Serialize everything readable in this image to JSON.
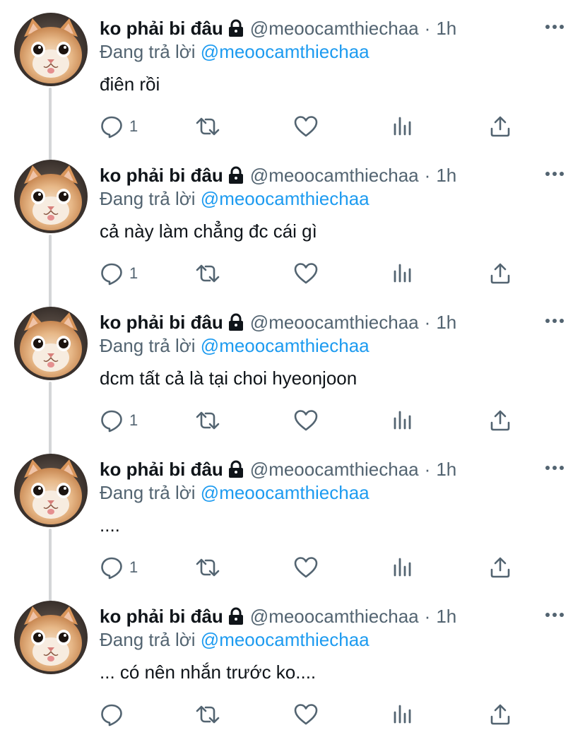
{
  "colors": {
    "text": "#0f1419",
    "secondary": "#536471",
    "link": "#1d9bf0",
    "thread": "#d4d6d8"
  },
  "tweets": [
    {
      "display_name": "ko phải bi đâu",
      "handle": "@meoocamthiechaa",
      "separator": "·",
      "time": "1h",
      "reply_prefix": "Đang trả lời",
      "reply_to": "@meoocamthiechaa",
      "text": "điên rồi",
      "reply_count": "1"
    },
    {
      "display_name": "ko phải bi đâu",
      "handle": "@meoocamthiechaa",
      "separator": "·",
      "time": "1h",
      "reply_prefix": "Đang trả lời",
      "reply_to": "@meoocamthiechaa",
      "text": "cả này làm chẳng đc cái gì",
      "reply_count": "1"
    },
    {
      "display_name": "ko phải bi đâu",
      "handle": "@meoocamthiechaa",
      "separator": "·",
      "time": "1h",
      "reply_prefix": "Đang trả lời",
      "reply_to": "@meoocamthiechaa",
      "text": "dcm tất cả là tại choi hyeonjoon",
      "reply_count": "1"
    },
    {
      "display_name": "ko phải bi đâu",
      "handle": "@meoocamthiechaa",
      "separator": "·",
      "time": "1h",
      "reply_prefix": "Đang trả lời",
      "reply_to": "@meoocamthiechaa",
      "text": "....",
      "reply_count": "1"
    },
    {
      "display_name": "ko phải bi đâu",
      "handle": "@meoocamthiechaa",
      "separator": "·",
      "time": "1h",
      "reply_prefix": "Đang trả lời",
      "reply_to": "@meoocamthiechaa",
      "text": "... có nên nhắn trước ko....",
      "reply_count": ""
    }
  ],
  "icons": {
    "avatar": "cat-avatar",
    "lock": "lock-icon",
    "more": "more-icon",
    "reply": "reply-icon",
    "retweet": "retweet-icon",
    "like": "heart-icon",
    "stats": "stats-icon",
    "share": "share-icon"
  }
}
